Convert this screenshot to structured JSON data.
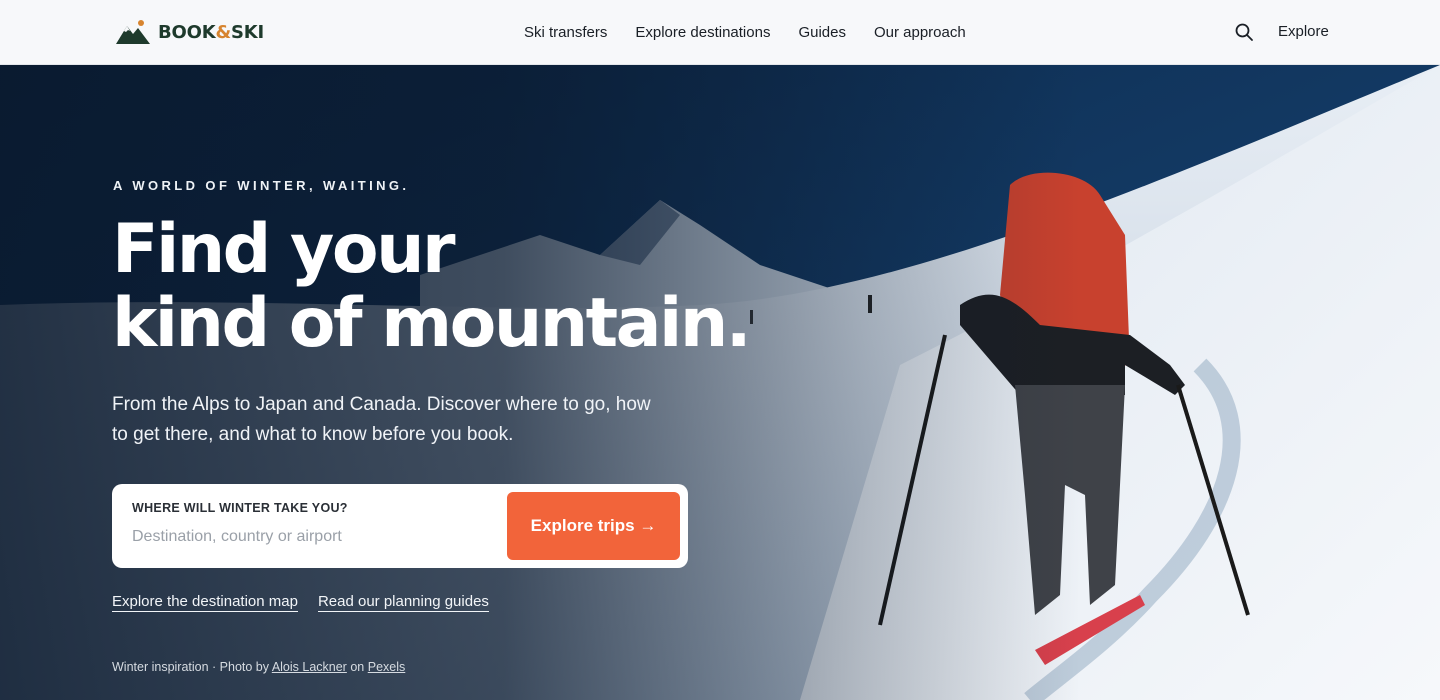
{
  "brand": {
    "logo_text_1": "BOOK",
    "logo_amp": "&",
    "logo_text_2": "SKI"
  },
  "nav": {
    "items": [
      {
        "label": "Ski transfers"
      },
      {
        "label": "Explore destinations"
      },
      {
        "label": "Guides"
      },
      {
        "label": "Our approach"
      }
    ],
    "explore_label": "Explore"
  },
  "hero": {
    "eyebrow": "A WORLD OF WINTER, WAITING.",
    "headline_line1": "Find your",
    "headline_line2": "kind of mountain.",
    "subtext": "From the Alps to Japan and Canada. Discover where to go, how to get there, and what to know before you book.",
    "search": {
      "label": "WHERE WILL WINTER TAKE YOU?",
      "placeholder": "Destination, country or airport",
      "value": "",
      "button_label": "Explore trips →"
    },
    "links": {
      "map": "Explore the destination map",
      "guides": "Read our planning guides"
    },
    "credit": {
      "prefix": "Winter inspiration · Photo by",
      "author": "Alois Lackner",
      "on": "on",
      "source": "Pexels"
    }
  },
  "colors": {
    "accent": "#f2643a",
    "brand_dark": "#1e3a2c",
    "brand_gold": "#d7842f",
    "header_bg": "#f7f8fa",
    "sky": "#133a63"
  }
}
